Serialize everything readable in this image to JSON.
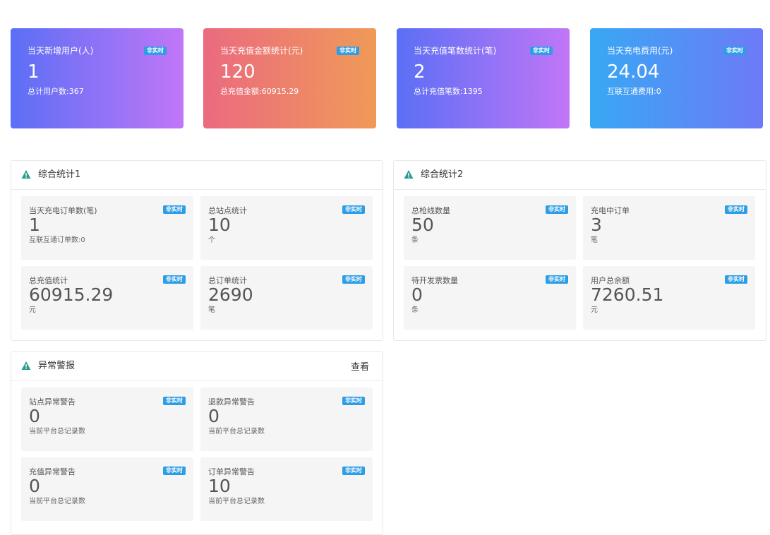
{
  "badge_text": "非实时",
  "top_cards": [
    {
      "title": "当天新增用户(人)",
      "value": "1",
      "sub": "总计用户数:367"
    },
    {
      "title": "当天充值金额统计(元)",
      "value": "120",
      "sub": "总充值金额:60915.29"
    },
    {
      "title": "当天充值笔数统计(笔)",
      "value": "2",
      "sub": "总计充值笔数:1395"
    },
    {
      "title": "当天充电费用(元)",
      "value": "24.04",
      "sub": "互联互通费用:0"
    }
  ],
  "panel1": {
    "title": "综合统计1",
    "items": [
      {
        "label": "当天充电订单数(笔)",
        "value": "1",
        "unit": "互联互通订单数:0"
      },
      {
        "label": "总站点统计",
        "value": "10",
        "unit": "个"
      },
      {
        "label": "总充值统计",
        "value": "60915.29",
        "unit": "元"
      },
      {
        "label": "总订单统计",
        "value": "2690",
        "unit": "笔"
      }
    ]
  },
  "panel2": {
    "title": "综合统计2",
    "items": [
      {
        "label": "总枪线数量",
        "value": "50",
        "unit": "条"
      },
      {
        "label": "充电中订单",
        "value": "3",
        "unit": "笔"
      },
      {
        "label": "待开发票数量",
        "value": "0",
        "unit": "条"
      },
      {
        "label": "用户总余额",
        "value": "7260.51",
        "unit": "元"
      }
    ]
  },
  "panel3": {
    "title": "异常警报",
    "link": "查看",
    "items": [
      {
        "label": "站点异常警告",
        "value": "0",
        "unit": "当前平台总记录数"
      },
      {
        "label": "退款异常警告",
        "value": "0",
        "unit": "当前平台总记录数"
      },
      {
        "label": "充值异常警告",
        "value": "0",
        "unit": "当前平台总记录数"
      },
      {
        "label": "订单异常警告",
        "value": "10",
        "unit": "当前平台总记录数"
      }
    ]
  },
  "colors": {
    "badge": "#2d9ee5",
    "warn_icon": "#2a9d8f"
  }
}
